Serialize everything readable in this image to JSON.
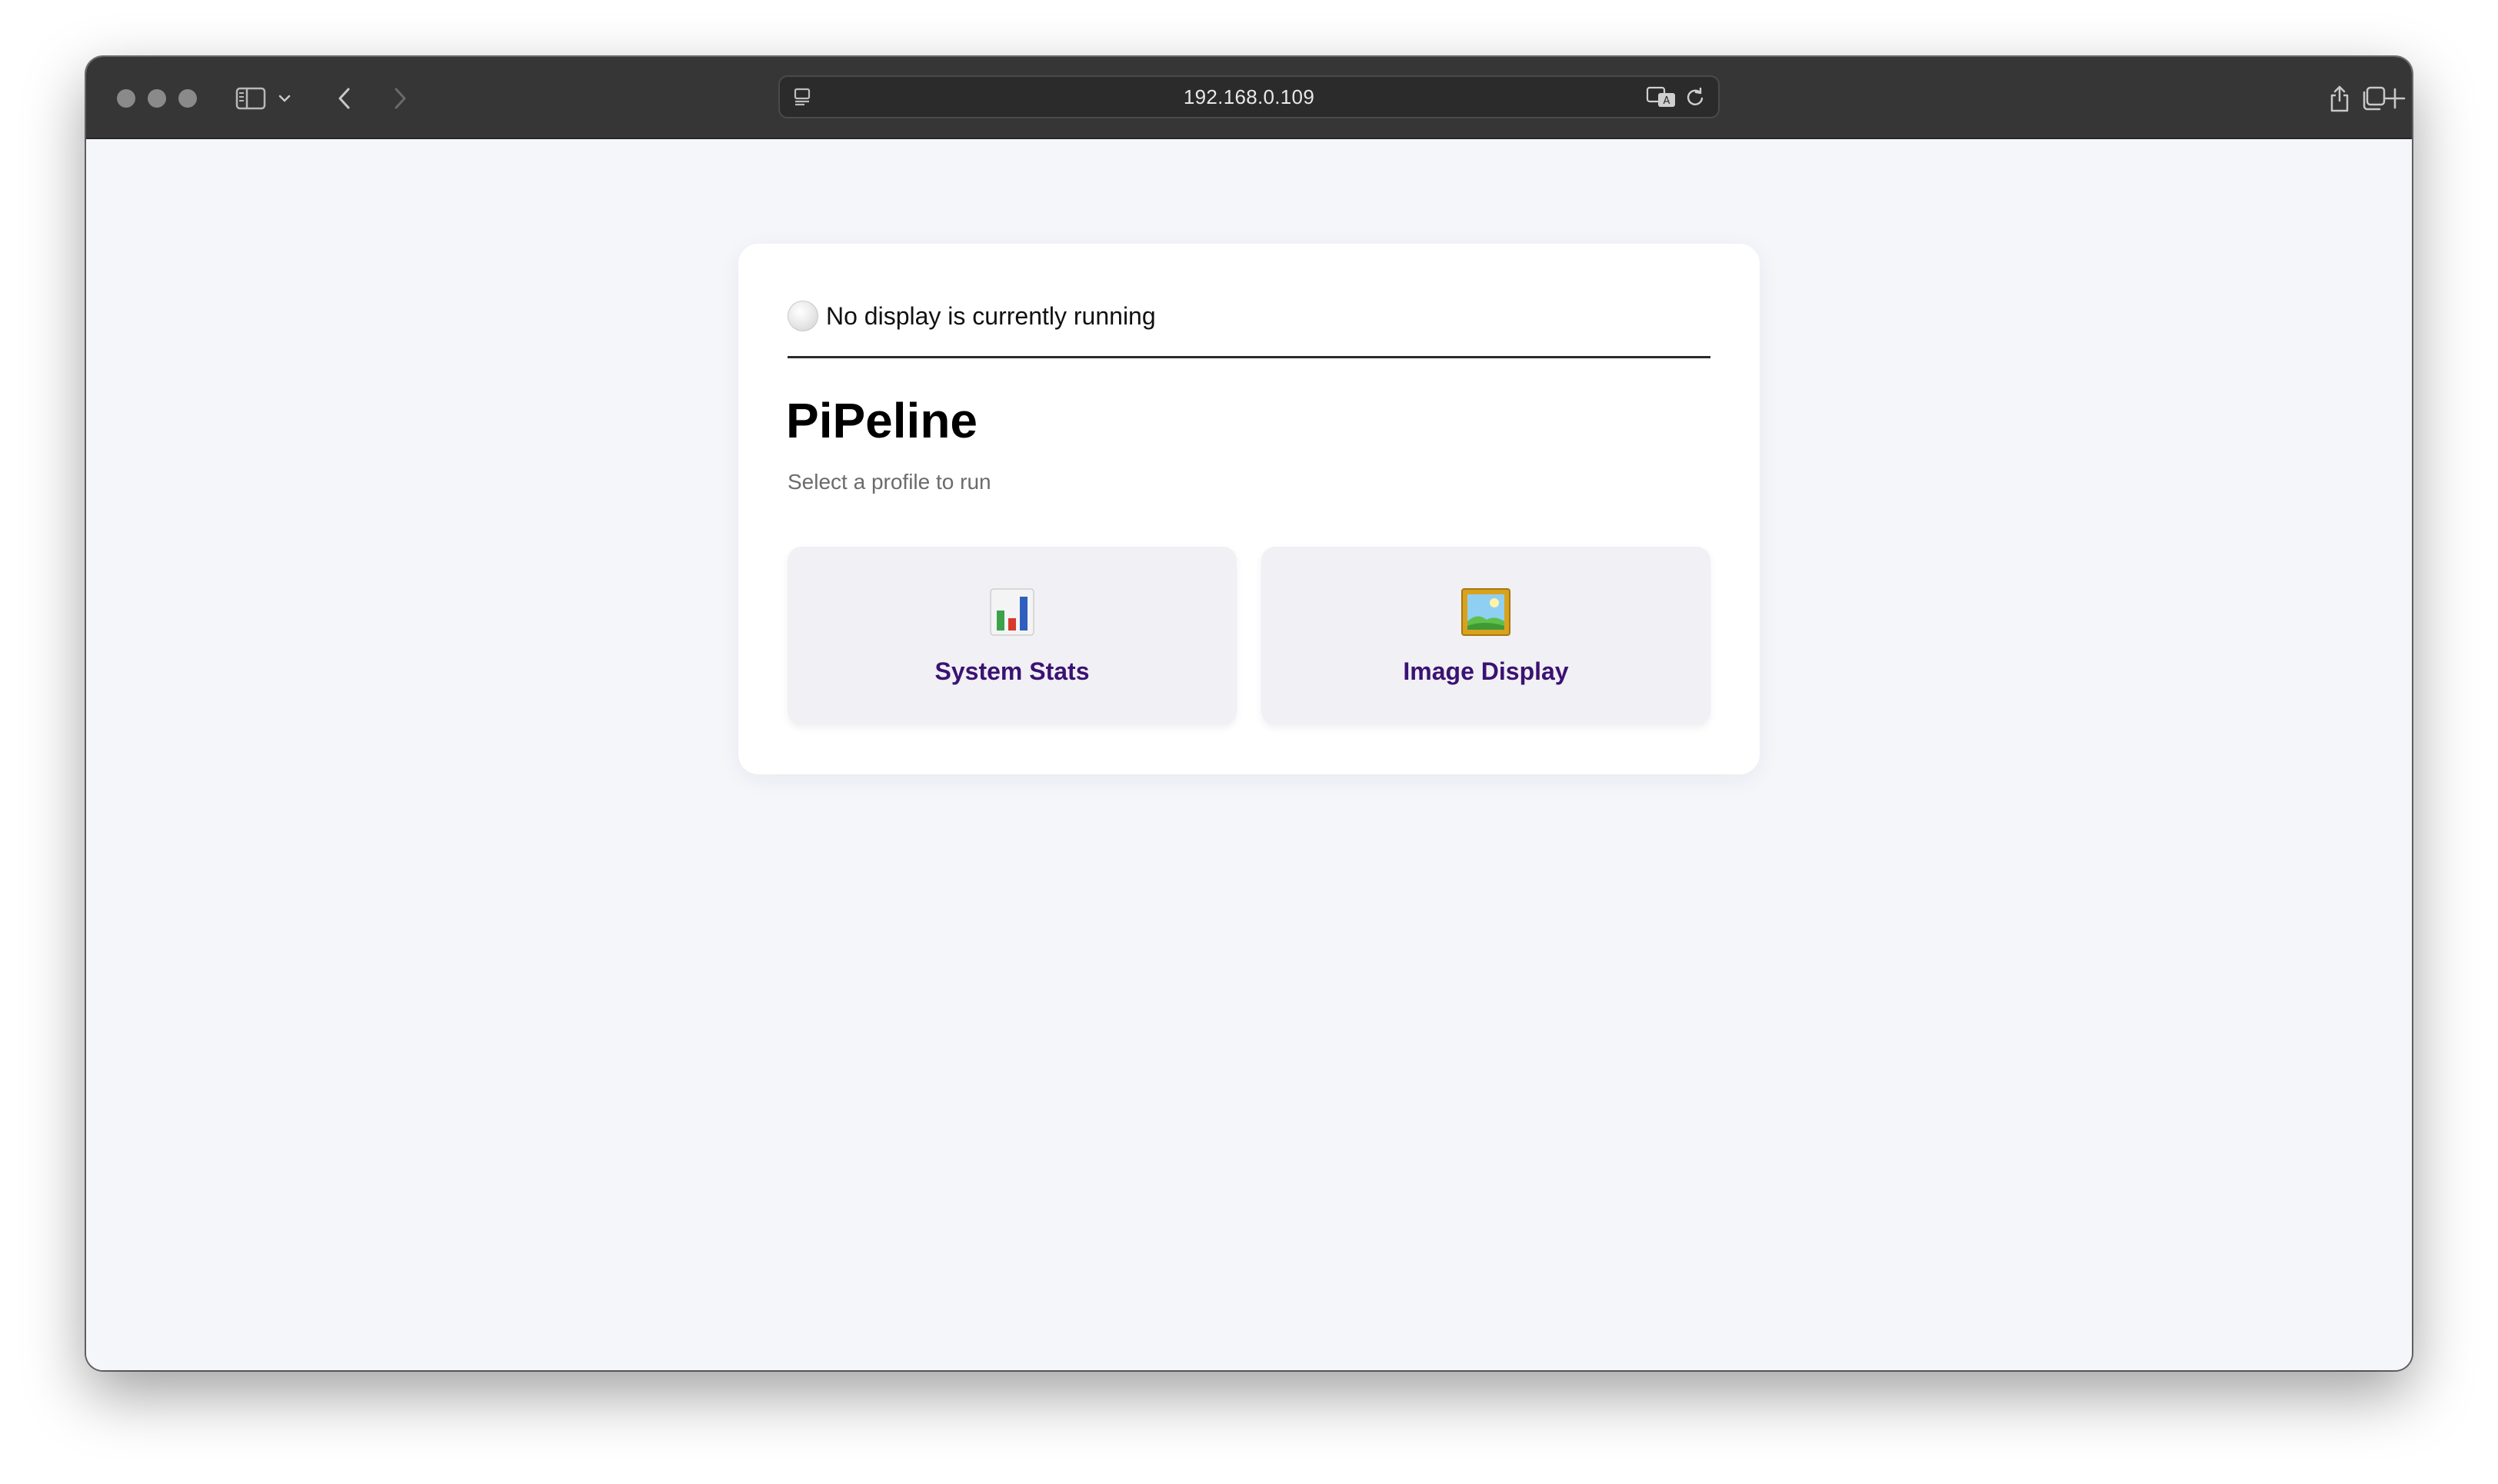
{
  "browser": {
    "address": "192.168.0.109"
  },
  "status": {
    "icon": "white-circle-icon",
    "text": "No display is currently running"
  },
  "page": {
    "title": "PiPeline",
    "subtitle": "Select a profile to run"
  },
  "profiles": [
    {
      "label": "System Stats",
      "icon": "bar-chart-icon"
    },
    {
      "label": "Image Display",
      "icon": "framed-picture-icon"
    }
  ],
  "colors": {
    "toolbar": "#363636",
    "page_background": "#f5f6fa",
    "card_background": "#ffffff",
    "profile_card_background": "#f0f0f5",
    "profile_label": "#3b1273",
    "subtitle": "#6b6b6b"
  }
}
